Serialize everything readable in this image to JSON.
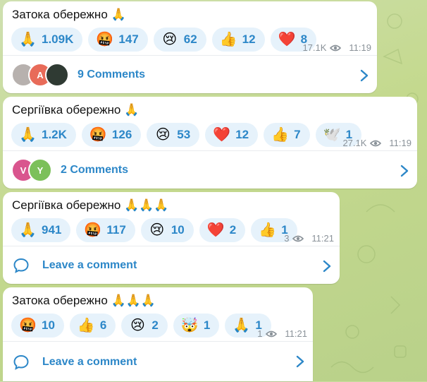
{
  "posts": [
    {
      "text": "Затока обережно 🙏",
      "reactions": [
        {
          "emoji": "🙏",
          "count": "1.09K"
        },
        {
          "emoji": "🤬",
          "count": "147"
        },
        {
          "emoji": "😢",
          "count": "62"
        },
        {
          "emoji": "👍",
          "count": "12"
        },
        {
          "emoji": "❤️",
          "count": "8"
        }
      ],
      "views": "17.1K",
      "time": "11:19",
      "comments_label": "9 Comments",
      "avatars": [
        {
          "letter": "",
          "color": "#b7b1ae"
        },
        {
          "letter": "A",
          "color": "#e86b59"
        },
        {
          "letter": "",
          "color": "#2f3a33"
        }
      ]
    },
    {
      "text": "Сергіївка обережно 🙏",
      "reactions": [
        {
          "emoji": "🙏",
          "count": "1.2K"
        },
        {
          "emoji": "🤬",
          "count": "126"
        },
        {
          "emoji": "😢",
          "count": "53"
        },
        {
          "emoji": "❤️",
          "count": "12"
        },
        {
          "emoji": "👍",
          "count": "7"
        },
        {
          "emoji": "🕊️",
          "count": "1"
        }
      ],
      "views": "27.1K",
      "time": "11:19",
      "comments_label": "2 Comments",
      "avatars": [
        {
          "letter": "V",
          "color": "#d9558e"
        },
        {
          "letter": "Y",
          "color": "#7cc05a"
        }
      ]
    },
    {
      "text": "Сергіївка обережно 🙏🙏🙏",
      "reactions": [
        {
          "emoji": "🙏",
          "count": "941"
        },
        {
          "emoji": "🤬",
          "count": "117"
        },
        {
          "emoji": "😢",
          "count": "10"
        },
        {
          "emoji": "❤️",
          "count": "2"
        },
        {
          "emoji": "👍",
          "count": "1"
        }
      ],
      "views": "3",
      "time": "11:21",
      "comments_label": "Leave a comment"
    },
    {
      "text": "Затока обережно 🙏🙏🙏",
      "reactions": [
        {
          "emoji": "🤬",
          "count": "10"
        },
        {
          "emoji": "👍",
          "count": "6"
        },
        {
          "emoji": "😢",
          "count": "2"
        },
        {
          "emoji": "🤯",
          "count": "1"
        },
        {
          "emoji": "🙏",
          "count": "1"
        }
      ],
      "views": "1",
      "time": "11:21",
      "comments_label": "Leave a comment"
    }
  ],
  "colors": {
    "accent": "#2c87c8",
    "pill_bg": "#e6f2fb",
    "meta": "#8a9299"
  }
}
